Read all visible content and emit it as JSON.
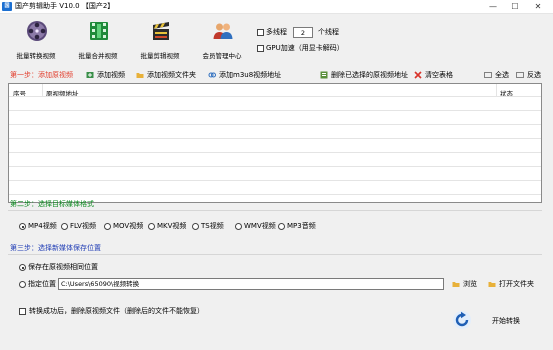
{
  "window": {
    "title": "国产剪辑助手 V10.0 【国产2】",
    "icon_text": "国"
  },
  "toolbar": [
    {
      "label": "批量转换视频",
      "icon": "film-reel-icon"
    },
    {
      "label": "批量合并视频",
      "icon": "film-strip-icon"
    },
    {
      "label": "批量剪辑视频",
      "icon": "clapper-board-icon"
    },
    {
      "label": "会员管理中心",
      "icon": "users-icon"
    }
  ],
  "options": {
    "multithread_label": "多线程",
    "thread_count": "2",
    "thread_unit": "个线程",
    "gpu_label": "GPU加速（用显卡解码）"
  },
  "step1": {
    "title": "第一步：添加原视频",
    "add_video": "添加视频",
    "add_folder": "添加视频文件夹",
    "add_m3u8": "添加m3u8视频地址",
    "delete_selected": "删除已选择的原视频地址",
    "clear_table": "清空表格",
    "select_all": "全选",
    "invert_select": "反选",
    "columns": [
      "序号",
      "原视频地址",
      "状态"
    ]
  },
  "step2": {
    "title": "第二步：选择目标媒体格式",
    "formats": [
      "MP4视频",
      "FLV视频",
      "MOV视频",
      "MKV视频",
      "TS视频",
      "WMV视频",
      "MP3音频"
    ],
    "selected": "MP4视频"
  },
  "step3": {
    "title": "第三步：选择新媒体保存位置",
    "same_location": "保存在原视频相同位置",
    "custom_location": "指定位置",
    "path_value": "C:\\Users\\65090\\视频转换",
    "browse": "浏览",
    "open_folder": "打开文件夹"
  },
  "footer": {
    "delete_original": "转换成功后，删除原视频文件（删除后的文件不能恢复）",
    "start": "开始转换"
  },
  "colors": {
    "step1": "#e23b2a",
    "step2": "#0a8a1e",
    "step3": "#1f3cb5"
  }
}
